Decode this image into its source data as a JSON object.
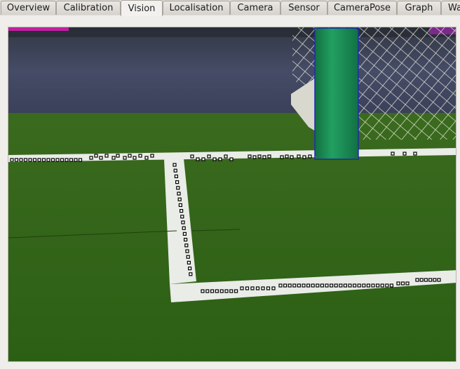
{
  "tabs": [
    {
      "label": "Overview",
      "active": false
    },
    {
      "label": "Calibration",
      "active": false
    },
    {
      "label": "Vision",
      "active": true
    },
    {
      "label": "Localisation",
      "active": false
    },
    {
      "label": "Camera",
      "active": false
    },
    {
      "label": "Sensor",
      "active": false
    },
    {
      "label": "CameraPose",
      "active": false
    },
    {
      "label": "Graph",
      "active": false
    },
    {
      "label": "Wa",
      "active": false
    }
  ],
  "colors": {
    "field_green": "#2f6617",
    "line_white": "#e9ece7",
    "goal_post_green": "#1a8a55",
    "bounding_box_blue": "#1c2ea8",
    "detection_marker": "#000000",
    "background_wall": "#3b4258"
  },
  "vision": {
    "detected_objects": [
      "goal-post"
    ],
    "marker_type": "line-point"
  }
}
